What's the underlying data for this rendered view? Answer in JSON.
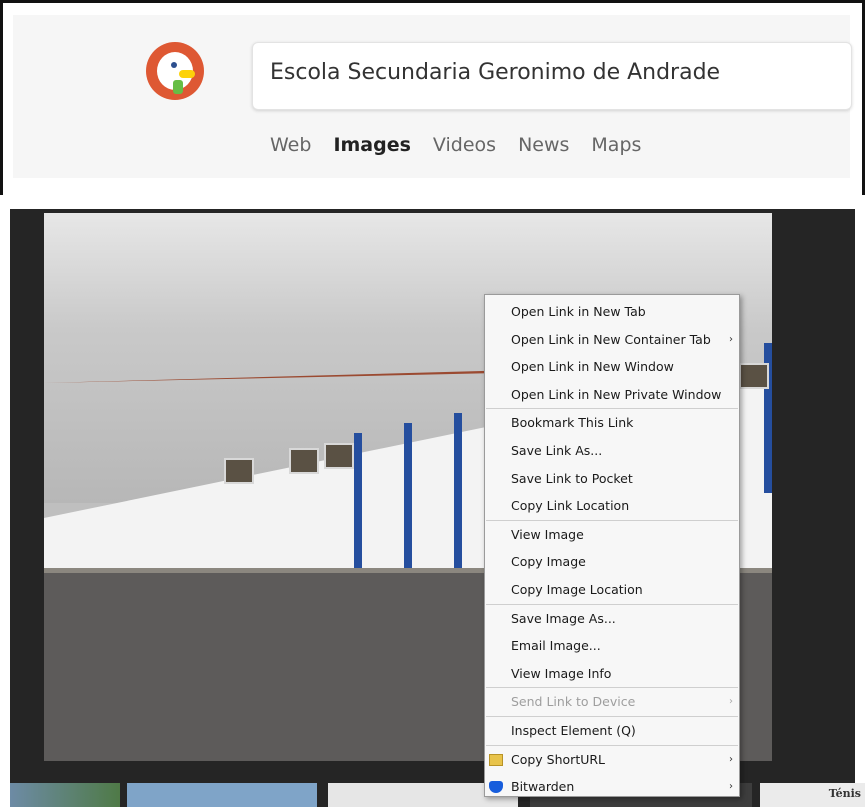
{
  "search": {
    "query": "Escola Secundaria Geronimo de Andrade"
  },
  "tabs": [
    {
      "label": "Web"
    },
    {
      "label": "Images"
    },
    {
      "label": "Videos"
    },
    {
      "label": "News"
    },
    {
      "label": "Maps"
    }
  ],
  "context_menu": {
    "items": [
      {
        "label": "Open Link in New Tab"
      },
      {
        "label": "Open Link in New Container Tab",
        "arrow": "›"
      },
      {
        "label": "Open Link in New Window"
      },
      {
        "label": "Open Link in New Private Window"
      },
      {
        "label": "Bookmark This Link"
      },
      {
        "label": "Save Link As..."
      },
      {
        "label": "Save Link to Pocket"
      },
      {
        "label": "Copy Link Location"
      },
      {
        "label": "View Image"
      },
      {
        "label": "Copy Image"
      },
      {
        "label": "Copy Image Location"
      },
      {
        "label": "Save Image As..."
      },
      {
        "label": "Email Image..."
      },
      {
        "label": "View Image Info"
      },
      {
        "label": "Send Link to Device",
        "arrow": "›"
      },
      {
        "label": "Inspect Element (Q)"
      },
      {
        "label": "Copy ShortURL",
        "arrow": "›"
      },
      {
        "label": "Bitwarden",
        "arrow": "›"
      }
    ]
  },
  "thumbnail_text": "Ténis",
  "colors": {
    "ddg_orange": "#de5833",
    "bitwarden_blue": "#175ddc",
    "viewer_bg": "#252525"
  }
}
